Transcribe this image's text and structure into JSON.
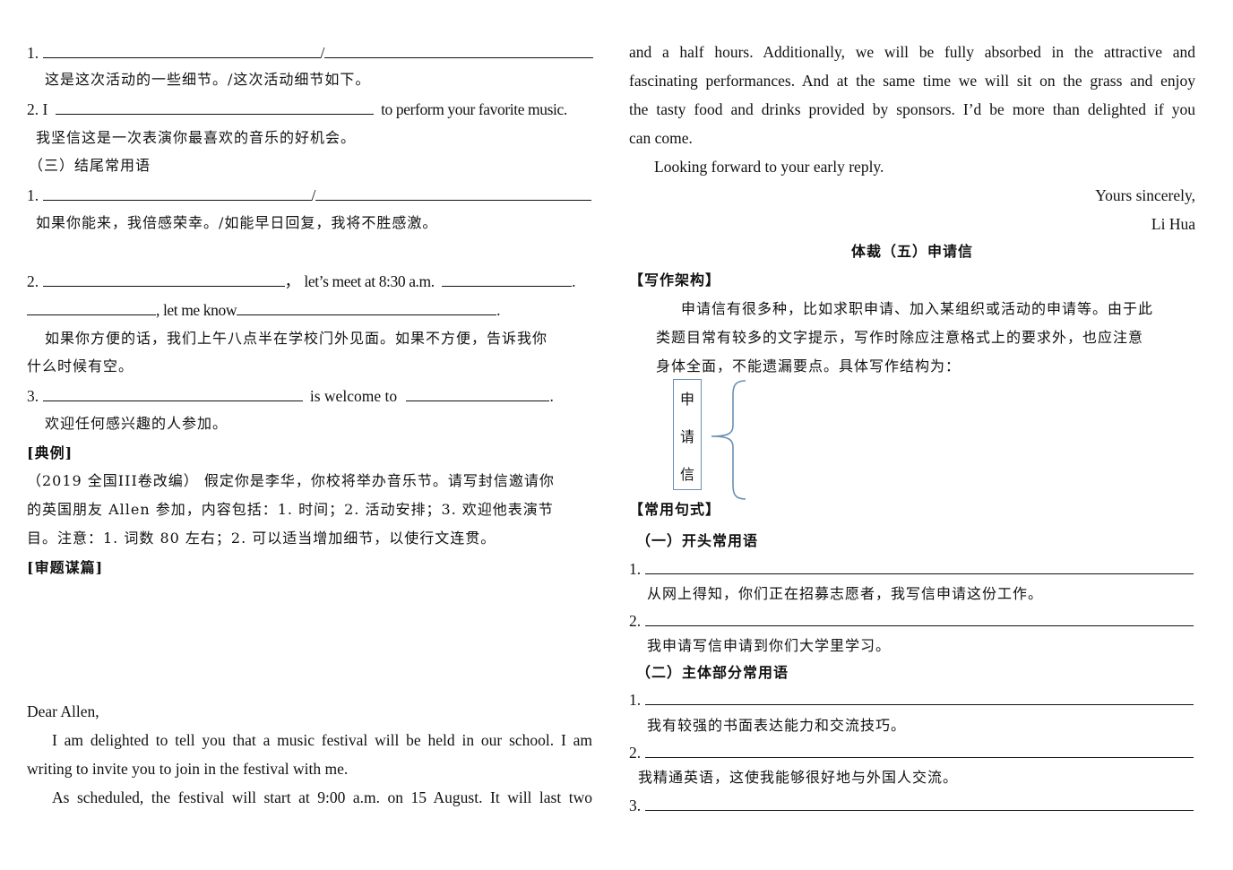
{
  "left": {
    "item1_prefix": "1.",
    "item1_slash": "/",
    "item1_zh": "这是这次活动的一些细节。/这次活动细节如下。",
    "item2_prefix": "2. I",
    "item2_suffix": "to perform your favorite music.",
    "item2_zh": "我坚信这是一次表演你最喜欢的音乐的好机会。",
    "closing_heading": "（三）结尾常用语",
    "closing1_prefix": "1.",
    "closing1_slash": "/",
    "closing1_zh": "如果你能来，我倍感荣幸。/如能早日回复，我将不胜感激。",
    "closing2_prefix": "2.",
    "closing2_comma": "，",
    "closing2_mid": "let’s meet at 8:30 a.m.",
    "closing2_end": ".",
    "closing2_line2_mid": ", let me know",
    "closing2_line2_end": ".",
    "closing2_zh_line1": "如果你方便的话，我们上午八点半在学校门外见面。如果不方便，告诉我你",
    "closing2_zh_line2": "什么时候有空。",
    "closing3_prefix": "3.",
    "closing3_mid": "is welcome to",
    "closing3_end": ".",
    "closing3_zh": "欢迎任何感兴趣的人参加。",
    "example_heading": "[典例]",
    "example_line1": "（2019 全国III卷改编） 假定你是李华，你校将举办音乐节。请写封信邀请你",
    "example_line2": "的英国朋友 Allen 参加，内容包括：1. 时间；2. 活动安排；3. 欢迎他表演节",
    "example_line3": "目。注意：1. 词数 80 左右；2. 可以适当增加细节，以使行文连贯。",
    "analysis_heading": "[审题谋篇]",
    "letter_salutation": "Dear Allen,",
    "letter_p1_line1": "I am delighted to tell you that a music festival will be held in our school. I am",
    "letter_p1_line2": "writing to invite you to join in the festival with me.",
    "letter_p2_line1": "As scheduled, the festival will start at 9:00 a.m. on 15 August. It will last two"
  },
  "right": {
    "letter_p2_line2": "and a half hours. Additionally, we will be fully absorbed in the attractive and",
    "letter_p2_line3": "fascinating performances. And at the same time we will sit on the grass and enjoy",
    "letter_p2_line4": "the tasty food and drinks provided by sponsors. I’d be more than delighted if you",
    "letter_p2_line5": "can come.",
    "letter_closing": "Looking forward to your early reply.",
    "letter_signoff": "Yours sincerely,",
    "letter_signature": "Li Hua",
    "section_title": "体裁（五）申请信",
    "structure_heading": "【写作架构】",
    "structure_line1": "申请信有很多种，比如求职申请、加入某组织或活动的申请等。由于此",
    "structure_line2": "类题目常有较多的文字提示，写作时除应注意格式上的要求外，也应注意",
    "structure_line3": "身体全面，不能遗漏要点。具体写作结构为：",
    "diagram_chars": [
      "申",
      "请",
      "信"
    ],
    "diagram_color": "#6b8fb5",
    "phrases_heading": "【常用句式】",
    "opening_heading": "（一）开头常用语",
    "opening1_prefix": "1.",
    "opening1_zh": "从网上得知，你们正在招募志愿者，我写信申请这份工作。",
    "opening2_prefix": "2.",
    "opening2_zh": "我申请写信申请到你们大学里学习。",
    "body_heading": "（二）主体部分常用语",
    "body1_prefix": "1.",
    "body1_zh": "我有较强的书面表达能力和交流技巧。",
    "body2_prefix": "2.",
    "body2_zh": "我精通英语，这使我能够很好地与外国人交流。",
    "body3_prefix": "3."
  }
}
